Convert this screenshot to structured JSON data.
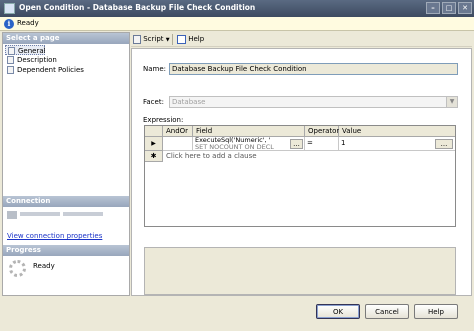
{
  "window": {
    "title": "Open Condition - Database Backup File Check Condition",
    "minimize": "–",
    "maximize": "□",
    "close": "✕"
  },
  "status": {
    "icon": "info-icon",
    "text": "Ready"
  },
  "left": {
    "select_page_header": "Select a page",
    "pages": [
      "General",
      "Description",
      "Dependent Policies"
    ],
    "connection_header": "Connection",
    "view_connection_link": "View connection properties",
    "progress_header": "Progress",
    "progress_status": "Ready"
  },
  "toolbar": {
    "script_label": "Script",
    "help_label": "Help"
  },
  "form": {
    "name_label": "Name:",
    "name_value": "Database Backup File Check Condition",
    "facet_label": "Facet:",
    "facet_value": "Database",
    "expression_label": "Expression:"
  },
  "grid": {
    "columns": [
      "AndOr",
      "Field",
      "Operator",
      "Value"
    ],
    "rows": [
      {
        "andor": "",
        "field_line1": "ExecuteSql('Numeric', '",
        "field_line2": "SET NOCOUNT ON DECL",
        "operator": "=",
        "value": "1"
      }
    ],
    "new_row_marker": "✱",
    "add_clause": "Click here to add a clause",
    "ellipsis": "..."
  },
  "buttons": {
    "ok": "OK",
    "cancel": "Cancel",
    "help": "Help"
  },
  "colors": {
    "titlebar": "#3d4a60",
    "section_header": "#98a6bc",
    "link": "#1a33c8",
    "status_bg": "#fffbe0"
  }
}
